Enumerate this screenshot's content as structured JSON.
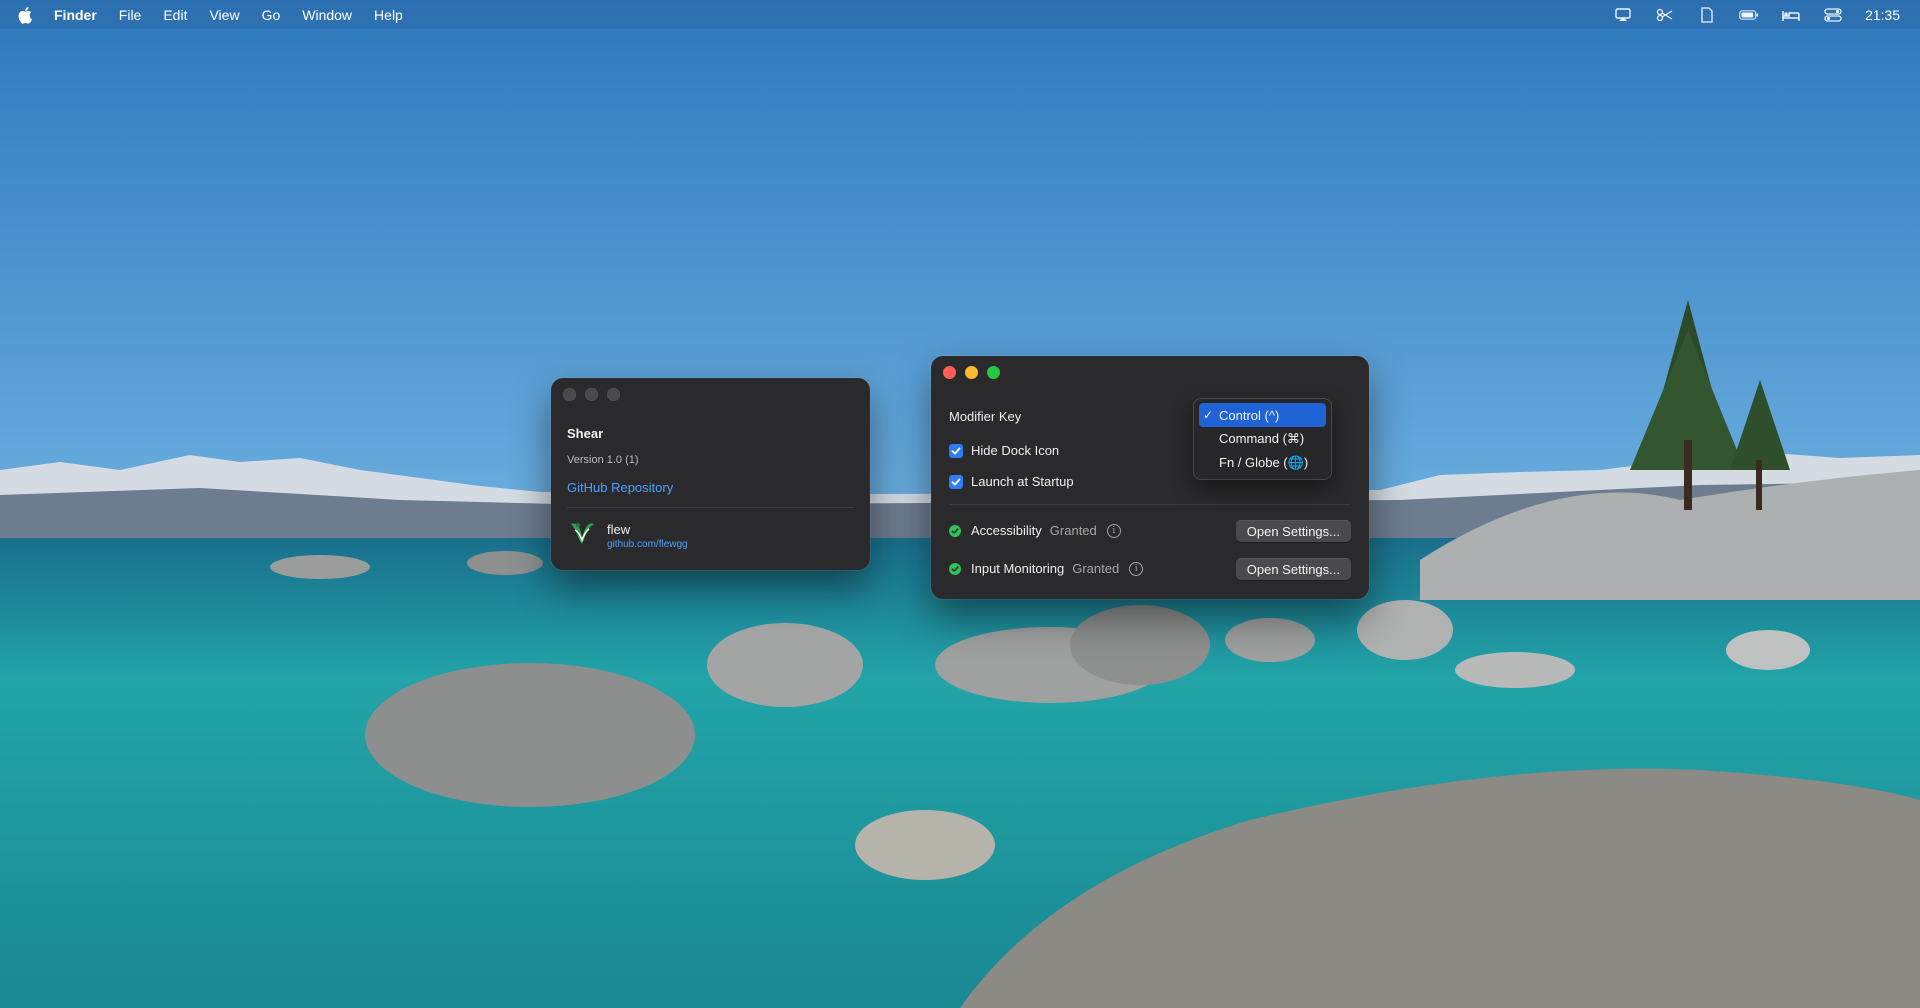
{
  "menubar": {
    "app_name": "Finder",
    "items": [
      "File",
      "Edit",
      "View",
      "Go",
      "Window",
      "Help"
    ],
    "clock": "21:35"
  },
  "about": {
    "app_title": "Shear",
    "version": "Version 1.0 (1)",
    "repo_link": "GitHub Repository",
    "author_name": "flew",
    "author_url": "github.com/flewgg"
  },
  "settings": {
    "modifier_label": "Modifier Key",
    "hide_dock_label": "Hide Dock Icon",
    "hide_dock_checked": true,
    "launch_startup_label": "Launch at Startup",
    "launch_startup_checked": true,
    "permissions": [
      {
        "name": "Accessibility",
        "status": "Granted",
        "button": "Open Settings..."
      },
      {
        "name": "Input Monitoring",
        "status": "Granted",
        "button": "Open Settings..."
      }
    ]
  },
  "modifier_menu": {
    "options": [
      "Control (^)",
      "Command (⌘)",
      "Fn / Globe (🌐)"
    ],
    "selected_index": 0
  },
  "colors": {
    "accent": "#2d7df6",
    "link": "#4ea0ff",
    "granted": "#30c15a",
    "selection": "#1f63d6"
  }
}
